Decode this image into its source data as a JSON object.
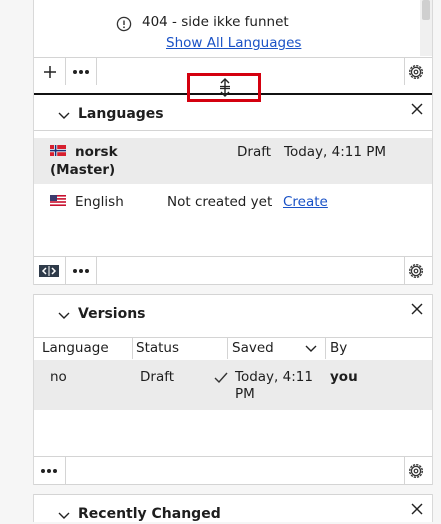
{
  "top": {
    "message": "404 - side ikke funnet",
    "show_all_link": "Show All Languages"
  },
  "languages": {
    "title": "Languages",
    "rows": [
      {
        "name": "norsk",
        "name2": "(Master)",
        "status": "Draft",
        "date": "Today, 4:11 PM",
        "flag": "norway-flag-icon"
      },
      {
        "name": "English",
        "status": "Not created yet",
        "action": "Create",
        "flag": "us-flag-icon"
      }
    ]
  },
  "versions": {
    "title": "Versions",
    "columns": [
      "Language",
      "Status",
      "Saved",
      "By"
    ],
    "row": {
      "language": "no",
      "status": "Draft",
      "saved_line1": "Today, 4:11",
      "saved_line2": "PM",
      "by": "you"
    }
  },
  "recent": {
    "title": "Recently Changed"
  },
  "colors": {
    "link": "#1a52c6",
    "highlight": "#d4000f",
    "row_bg": "#ebebeb"
  }
}
